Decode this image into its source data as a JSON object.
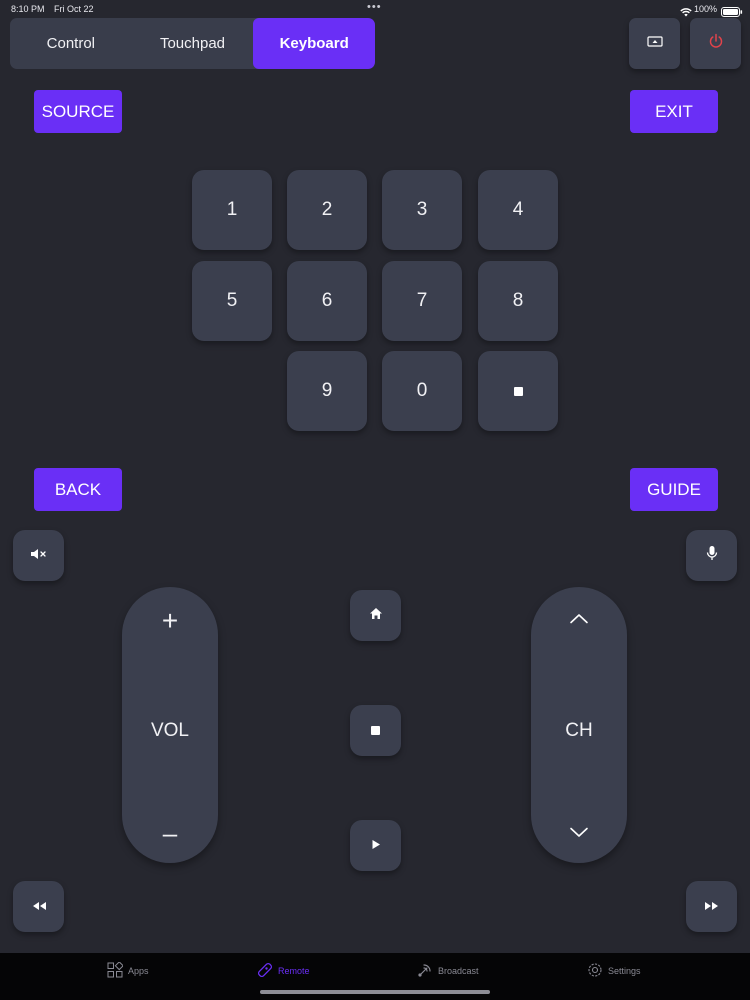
{
  "status_bar": {
    "time": "8:10 PM",
    "date": "Fri Oct 22",
    "battery": "100%",
    "dots": "•••"
  },
  "tabs": [
    {
      "label": "Control"
    },
    {
      "label": "Touchpad"
    },
    {
      "label": "Keyboard"
    }
  ],
  "active_tab": "Keyboard",
  "buttons": {
    "source": "SOURCE",
    "exit": "EXIT",
    "back": "BACK",
    "guide": "GUIDE"
  },
  "keypad": {
    "row1": [
      "1",
      "2",
      "3",
      "4"
    ],
    "row2": [
      "5",
      "6",
      "7",
      "8"
    ],
    "row3": [
      "9",
      "0"
    ]
  },
  "volume": {
    "label": "VOL",
    "plus": "+",
    "minus": "–"
  },
  "channel": {
    "label": "CH"
  },
  "bottom_nav": {
    "items": [
      {
        "label": "Apps",
        "icon": "apps-icon"
      },
      {
        "label": "Remote",
        "icon": "remote-icon"
      },
      {
        "label": "Broadcast",
        "icon": "broadcast-icon"
      },
      {
        "label": "Settings",
        "icon": "settings-icon"
      }
    ],
    "active": "Remote"
  },
  "colors": {
    "accent": "#6a2ff6",
    "background": "#26272f",
    "tile": "#3b3f4e",
    "power_icon": "#e2434b"
  }
}
